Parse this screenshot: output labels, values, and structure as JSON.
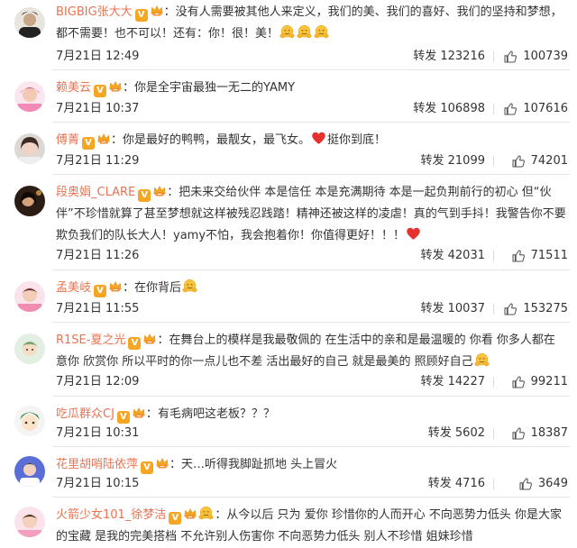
{
  "repost_label": "转发",
  "comments": [
    {
      "username": "BIGBIG张大大",
      "segments": [
        "没有人需要被其他人来定义，我们的美、我们的喜好、我们的坚持和梦想，都不需要！也不可以！还有：你！很！美！"
      ],
      "emojis": [
        "hug-emoji",
        "hug-emoji",
        "hug-emoji"
      ],
      "time": "7月21日 12:49",
      "reposts": "123216",
      "likes": "100739"
    },
    {
      "username": "赖美云",
      "segments": [
        "你是全宇宙最独一无二的YAMY"
      ],
      "time": "7月21日 10:37",
      "reposts": "106898",
      "likes": "107616"
    },
    {
      "username": "傅菁",
      "segments": [
        "你是最好的鸭鸭，最靓女，最飞女。",
        "挺你到底！"
      ],
      "time": "7月21日 11:29",
      "reposts": "21099",
      "likes": "74201"
    },
    {
      "username": "段奥娟_CLARE",
      "segments": [
        "把未来交给伙伴 本是信任 本是充满期待 本是一起负荆前行的初心 但“伙伴”不珍惜就算了甚至梦想就这样被残忍践踏！精神还被这样的凌虐！真的气到手抖！我警告你不要欺负我们的队长大人！yamy不怕，我会抱着你！你值得更好！！！"
      ],
      "time": "7月21日 11:26",
      "reposts": "42031",
      "likes": "71511"
    },
    {
      "username": "孟美岐",
      "segments": [
        "在你背后"
      ],
      "time": "7月21日 11:55",
      "reposts": "10037",
      "likes": "153275"
    },
    {
      "username": "R1SE-夏之光",
      "segments": [
        "在舞台上的模样是我最敬佩的 在生活中的亲和是最温暖的 你看 你多人都在意你 欣赏你 所以平时的你一点儿也不差 活出最好的自己 就是最美的 照顾好自己"
      ],
      "time": "7月21日 12:09",
      "reposts": "14227",
      "likes": "99211"
    },
    {
      "username": "吃瓜群众CJ",
      "segments": [
        "有毛病吧这老板？？？"
      ],
      "time": "7月21日 10:31",
      "reposts": "5602",
      "likes": "18387"
    },
    {
      "username": "花里胡哨陆依萍",
      "segments": [
        "天…听得我脚趾抓地 头上冒火"
      ],
      "time": "7月21日 10:15",
      "reposts": "4716",
      "likes": "3649"
    },
    {
      "username": "火箭少女101_徐梦洁",
      "segments": [
        "从今以后 只为 爱你 珍惜你的人而开心 不向恶势力低头 你是大家的宝藏 是我的完美搭档 不允许别人伤害你 不向恶势力低头 别人不珍惜 姐妹珍惜"
      ],
      "time": "",
      "reposts": "",
      "likes": ""
    }
  ]
}
